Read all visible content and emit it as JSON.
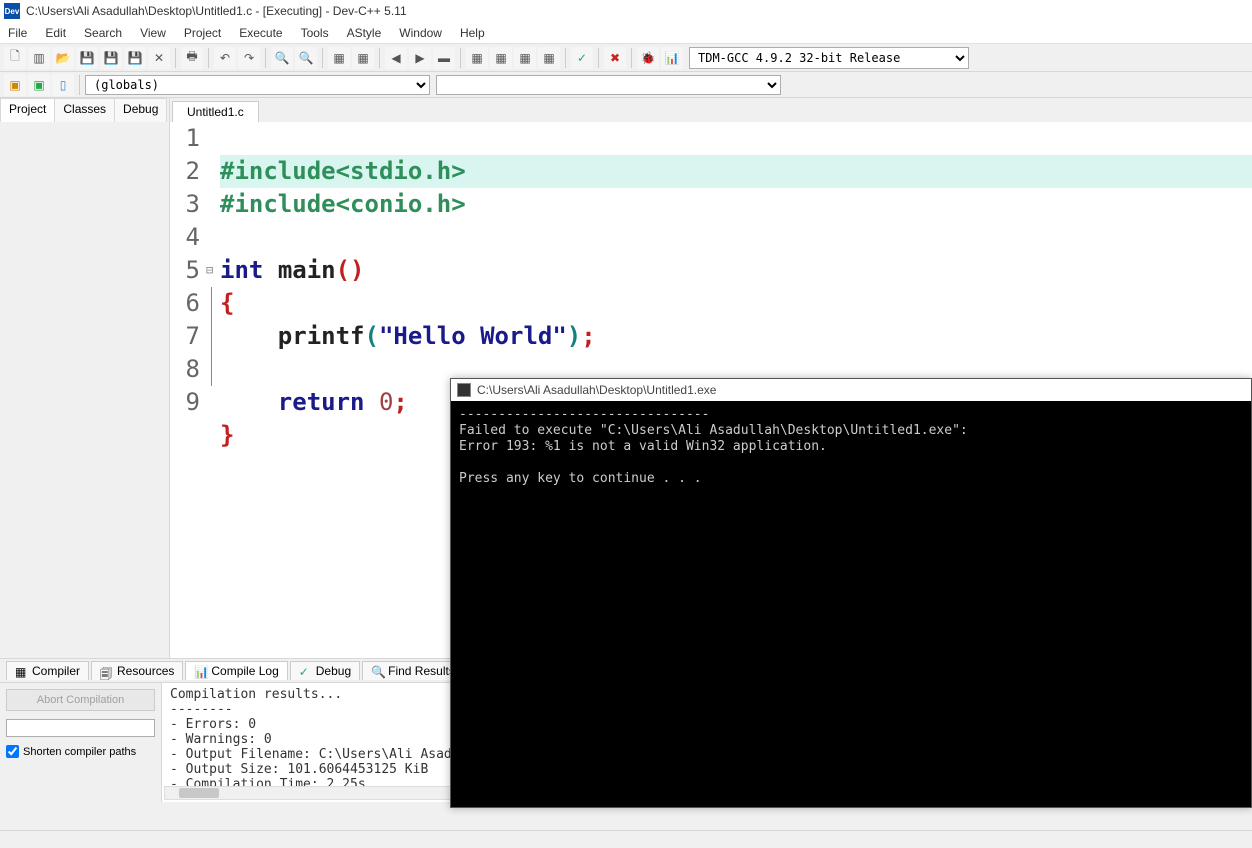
{
  "title": "C:\\Users\\Ali Asadullah\\Desktop\\Untitled1.c - [Executing] - Dev-C++ 5.11",
  "menu": [
    "File",
    "Edit",
    "Search",
    "View",
    "Project",
    "Execute",
    "Tools",
    "AStyle",
    "Window",
    "Help"
  ],
  "compiler_dropdown": "TDM-GCC 4.9.2 32-bit Release",
  "scope_dropdown": "(globals)",
  "left_tabs": [
    "Project",
    "Classes",
    "Debug"
  ],
  "file_tab": "Untitled1.c",
  "code": {
    "lines": [
      {
        "n": "1",
        "pre": "#include",
        "ang": "<stdio.h>"
      },
      {
        "n": "2",
        "pre": "#include",
        "ang": "<conio.h>"
      },
      {
        "n": "3"
      },
      {
        "n": "4",
        "kw": "int",
        "id": "main",
        "par": "()"
      },
      {
        "n": "5",
        "brace": "{"
      },
      {
        "n": "6",
        "call": "printf",
        "paren_open": "(",
        "str": "\"Hello World\"",
        "paren_close": ")",
        "semi": ";"
      },
      {
        "n": "7"
      },
      {
        "n": "8",
        "kw": "return",
        "num": "0",
        "semi": ";"
      },
      {
        "n": "9",
        "brace": "}"
      }
    ]
  },
  "bottom_tabs": [
    "Compiler",
    "Resources",
    "Compile Log",
    "Debug",
    "Find Results"
  ],
  "abort_label": "Abort Compilation",
  "shorten_label": "Shorten compiler paths",
  "compile_log": "Compilation results...\n--------\n- Errors: 0\n- Warnings: 0\n- Output Filename: C:\\Users\\Ali Asad\n- Output Size: 101.6064453125 KiB\n- Compilation Time: 2.25s",
  "console": {
    "title": "C:\\Users\\Ali Asadullah\\Desktop\\Untitled1.exe",
    "body": "--------------------------------\nFailed to execute \"C:\\Users\\Ali Asadullah\\Desktop\\Untitled1.exe\":\nError 193: %1 is not a valid Win32 application.\n\nPress any key to continue . . ."
  }
}
